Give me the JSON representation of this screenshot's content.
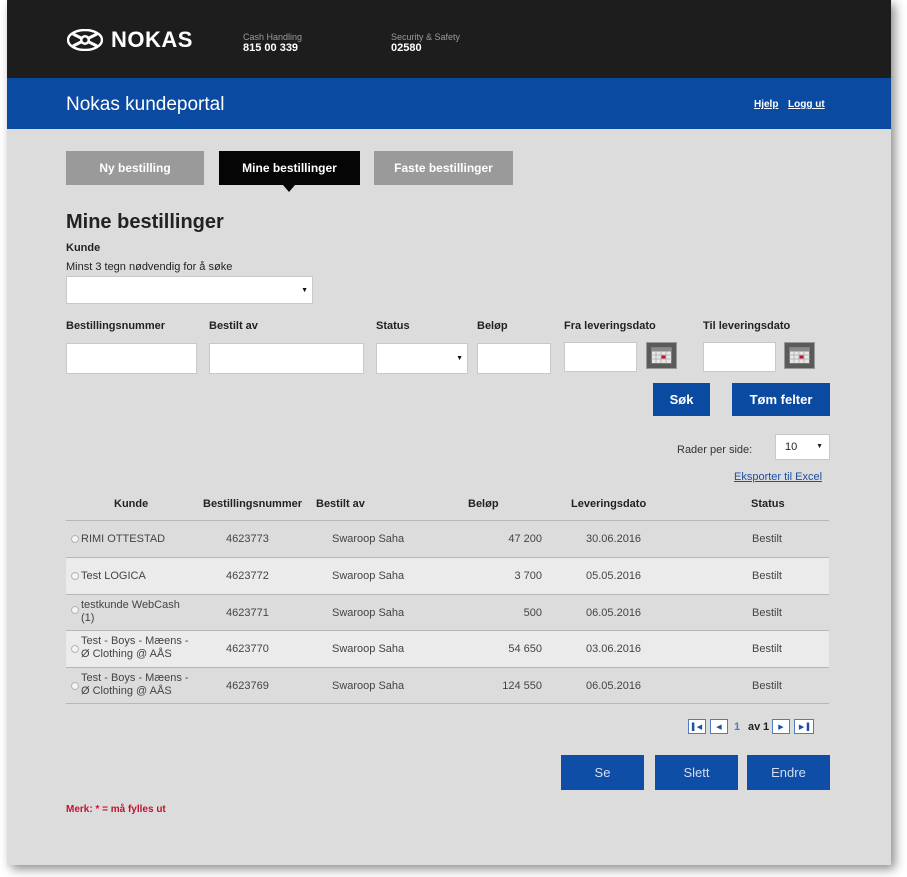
{
  "header": {
    "logo_text": "NOKAS",
    "contacts": [
      {
        "label": "Cash Handling",
        "number": "815 00 339"
      },
      {
        "label": "Security & Safety",
        "number": "02580"
      }
    ]
  },
  "nav": {
    "portal_title": "Nokas kundeportal",
    "help": "Hjelp",
    "logout": "Logg ut"
  },
  "tabs": [
    {
      "label": "Ny bestilling"
    },
    {
      "label": "Mine bestillinger",
      "active": true
    },
    {
      "label": "Faste bestillinger"
    }
  ],
  "page": {
    "title": "Mine bestillinger",
    "customer_label": "Kunde",
    "customer_hint": "Minst 3 tegn nødvendig for å søke"
  },
  "filters": {
    "order_number": "Bestillingsnummer",
    "ordered_by": "Bestilt av",
    "status": "Status",
    "amount": "Beløp",
    "from_date": "Fra leveringsdato",
    "to_date": "Til leveringsdato"
  },
  "buttons": {
    "search": "Søk",
    "clear": "Tøm felter",
    "view": "Se",
    "delete": "Slett",
    "edit": "Endre"
  },
  "table": {
    "rows_per_page_label": "Rader per side:",
    "rows_per_page_value": "10",
    "export": "Eksporter til Excel",
    "headers": [
      "Kunde",
      "Bestillingsnummer",
      "Bestilt av",
      "Beløp",
      "Leveringsdato",
      "Status"
    ],
    "rows": [
      {
        "kunde": "RIMI OTTESTAD",
        "kunde2": "",
        "nr": "4623773",
        "av": "Swaroop Saha",
        "belop": "47 200",
        "dato": "30.06.2016",
        "status": "Bestilt"
      },
      {
        "kunde": "Test LOGICA",
        "kunde2": "",
        "nr": "4623772",
        "av": "Swaroop Saha",
        "belop": "3 700",
        "dato": "05.05.2016",
        "status": "Bestilt"
      },
      {
        "kunde": "testkunde WebCash",
        "kunde2": "(1)",
        "nr": "4623771",
        "av": "Swaroop Saha",
        "belop": "500",
        "dato": "06.05.2016",
        "status": "Bestilt"
      },
      {
        "kunde": "Test - Boys - Mæens -",
        "kunde2": "Ø Clothing @ AÅS",
        "nr": "4623770",
        "av": "Swaroop Saha",
        "belop": "54 650",
        "dato": "03.06.2016",
        "status": "Bestilt"
      },
      {
        "kunde": "Test - Boys - Mæens -",
        "kunde2": "Ø Clothing @ AÅS",
        "nr": "4623769",
        "av": "Swaroop Saha",
        "belop": "124 550",
        "dato": "06.05.2016",
        "status": "Bestilt"
      }
    ]
  },
  "pager": {
    "current": "1",
    "of_label": "av",
    "total": "1"
  },
  "footer_note": "Merk: * = må fylles ut",
  "colors": {
    "brand_blue": "#0b4aa1",
    "topbar": "#1d1d1d",
    "required_red": "#c8102e"
  }
}
